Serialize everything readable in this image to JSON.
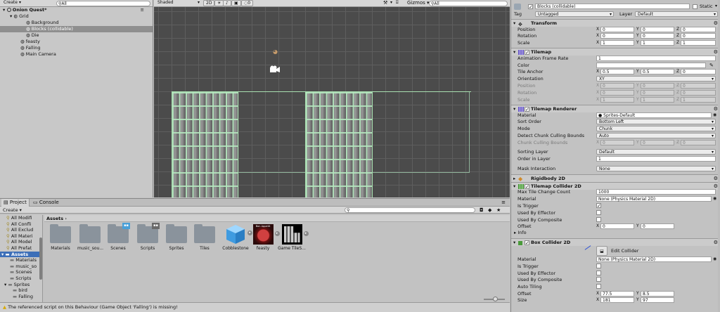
{
  "hierarchy": {
    "create": "Create",
    "search": "All",
    "scene_name": "Onion Quest*",
    "items": [
      {
        "label": "Grid",
        "indent": 1
      },
      {
        "label": "Background",
        "indent": 2
      },
      {
        "label": "Blocks (collidable)",
        "indent": 2,
        "selected": true
      },
      {
        "label": "Die",
        "indent": 2
      },
      {
        "label": "feasty",
        "indent": 1
      },
      {
        "label": "Falling",
        "indent": 1
      },
      {
        "label": "Main Camera",
        "indent": 1
      }
    ]
  },
  "scene": {
    "shading": "Shaded",
    "mode_2d": "2D",
    "layer_count": "0",
    "gizmos": "Gizmos",
    "search": "All"
  },
  "inspector": {
    "object_name": "Blocks (collidable)",
    "static_label": "Static",
    "tag_label": "Tag",
    "tag_value": "Untagged",
    "layer_label": "Layer",
    "layer_value": "Default",
    "transform": {
      "title": "Transform",
      "position": {
        "label": "Position",
        "x": "0",
        "y": "0",
        "z": "0"
      },
      "rotation": {
        "label": "Rotation",
        "x": "0",
        "y": "0",
        "z": "0"
      },
      "scale": {
        "label": "Scale",
        "x": "1",
        "y": "1",
        "z": "1"
      }
    },
    "tilemap": {
      "title": "Tilemap",
      "frame_rate_label": "Animation Frame Rate",
      "frame_rate": "1",
      "color_label": "Color",
      "anchor_label": "Tile Anchor",
      "anchor": {
        "x": "0.5",
        "y": "0.5",
        "z": "0"
      },
      "orientation_label": "Orientation",
      "orientation": "XY",
      "position": {
        "label": "Position",
        "x": "0",
        "y": "0",
        "z": "0"
      },
      "rotation": {
        "label": "Rotation",
        "x": "0",
        "y": "0",
        "z": "0"
      },
      "scale": {
        "label": "Scale",
        "x": "1",
        "y": "1",
        "z": "1"
      }
    },
    "renderer": {
      "title": "Tilemap Renderer",
      "material_label": "Material",
      "material": "Sprites-Default",
      "sort_label": "Sort Order",
      "sort": "Bottom Left",
      "mode_label": "Mode",
      "mode": "Chunk",
      "culling_label": "Detect Chunk Culling Bounds",
      "culling": "Auto",
      "chunk_label": "Chunk Culling Bounds",
      "chunk": {
        "x": "0",
        "y": "0",
        "z": "0"
      },
      "sorting_layer_label": "Sorting Layer",
      "sorting_layer": "Default",
      "order_label": "Order in Layer",
      "order": "1",
      "mask_label": "Mask Interaction",
      "mask": "None"
    },
    "rigidbody": {
      "title": "Rigidbody 2D"
    },
    "tilemap_collider": {
      "title": "Tilemap Collider 2D",
      "max_tile_label": "Max Tile Change Count",
      "max_tile": "1000",
      "material_label": "Material",
      "material": "None (Physics Material 2D)",
      "trigger_label": "Is Trigger",
      "effector_label": "Used By Effector",
      "composite_label": "Used By Composite",
      "offset_label": "Offset",
      "offset": {
        "x": "0",
        "y": "0"
      },
      "info_label": "Info"
    },
    "box_collider": {
      "title": "Box Collider 2D",
      "edit_label": "Edit Collider",
      "material_label": "Material",
      "material": "None (Physics Material 2D)",
      "trigger_label": "Is Trigger",
      "effector_label": "Used By Effector",
      "composite_label": "Used By Composite",
      "tiling_label": "Auto Tiling",
      "offset_label": "Offset",
      "offset": {
        "x": "77.5",
        "y": "8.5"
      },
      "size_label": "Size",
      "size": {
        "x": "181",
        "y": "97"
      }
    }
  },
  "project": {
    "tab_project": "Project",
    "tab_console": "Console",
    "create": "Create",
    "breadcrumb": "Assets",
    "tree": [
      "All Modifi",
      "All Confli",
      "All Exclud",
      "All Materi",
      "All Model",
      "All Prefat",
      "Assets",
      "Materials",
      "music_so",
      "Scenes",
      "Scripts",
      "Sprites",
      "bird",
      "Falling"
    ],
    "assets": [
      "Materials",
      "music_sou...",
      "Scenes",
      "Scripts",
      "Sprites",
      "Tiles",
      "Cobblestone",
      "feasty",
      "Game TileS..."
    ],
    "thumb_text": "Bon Appetit"
  },
  "status": "The referenced script on this Behaviour (Game Object 'Falling') is missing!",
  "colors": {
    "selection": "#8f8f8f",
    "scene_bg": "#4b4b4b",
    "tile_outline": "#a8e0b0"
  }
}
